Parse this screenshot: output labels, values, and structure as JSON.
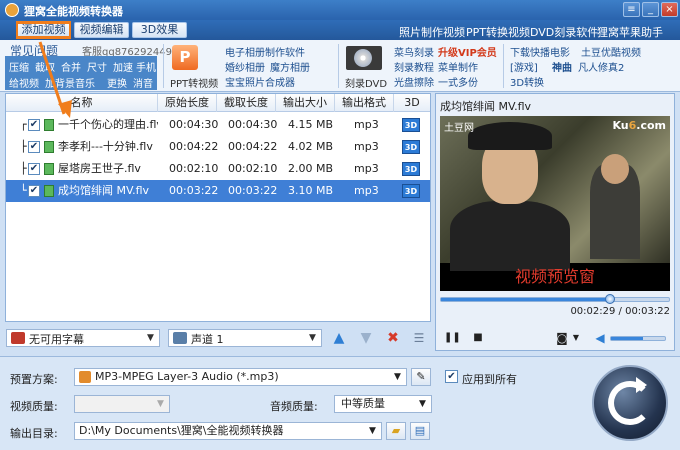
{
  "app": {
    "title": "狸窝全能视频转换器"
  },
  "toolbar": {
    "tabs": [
      "添加视频",
      "视频编辑",
      "3D效果"
    ],
    "links": [
      "照片制作视频",
      "PPT转换视频",
      "DVD刻录软件",
      "狸窝苹果助手"
    ]
  },
  "promo": {
    "heading": "常见问题",
    "qq": "客服qq876292449",
    "tiles": [
      "压缩",
      "截取",
      "合并",
      "尺寸",
      "加速",
      "手机",
      "给视频",
      "加背景音乐",
      "更换",
      "消音"
    ],
    "ppt_label": "PPT转视频",
    "photo_links": [
      "电子相册制作软件",
      "婚纱相册",
      "魔方相册",
      "宝宝照片合成器"
    ],
    "dvd_label": "刻录DVD",
    "dvd_links": [
      "菜鸟刻录",
      "升级VIP会员",
      "刻录教程",
      "菜单制作",
      "光盘擦除",
      "一式多份"
    ],
    "right_links": [
      "下载快播电影",
      "土豆优酷视频",
      "[游戏]",
      "神曲",
      "凡人修真2",
      "3D转换"
    ]
  },
  "file_list": {
    "columns": [
      "名称",
      "原始长度",
      "截取长度",
      "输出大小",
      "输出格式",
      "3D"
    ],
    "rows": [
      {
        "name": "一千个伤心的理由.flv",
        "orig": "00:04:30",
        "cut": "00:04:30",
        "size": "4.15 MB",
        "format": "mp3",
        "badge": "3D",
        "checked": "✔"
      },
      {
        "name": "李孝利---十分钟.flv",
        "orig": "00:04:22",
        "cut": "00:04:22",
        "size": "4.02 MB",
        "format": "mp3",
        "badge": "3D",
        "checked": "✔"
      },
      {
        "name": "屋塔房王世子.flv",
        "orig": "00:02:10",
        "cut": "00:02:10",
        "size": "2.00 MB",
        "format": "mp3",
        "badge": "3D",
        "checked": "✔"
      },
      {
        "name": "成均馆绯闻 MV.flv",
        "orig": "00:03:22",
        "cut": "00:03:22",
        "size": "3.10 MB",
        "format": "mp3",
        "badge": "3D",
        "checked": "✔"
      }
    ]
  },
  "list_controls": {
    "subtitle_value": "无可用字幕",
    "audio_track_value": "声道 1"
  },
  "preview": {
    "title": "成均馆绯闻 MV.flv",
    "watermark_left": "土豆网",
    "watermark_right_a": "Ku",
    "watermark_right_b": "6",
    "watermark_right_c": ".com",
    "caption": "视频预览窗",
    "time_readout": "00:02:29 / 00:03:22",
    "progress": 0.74,
    "volume": 0.6
  },
  "output": {
    "preset_label": "预置方案:",
    "preset_value": "MP3-MPEG Layer-3 Audio (*.mp3)",
    "apply_all_label": "应用到所有",
    "apply_all_checked": "✔",
    "video_quality_label": "视频质量:",
    "audio_quality_label": "音频质量:",
    "audio_quality_value": "中等质量",
    "dir_label": "输出目录:",
    "dir_value": "D:\\My Documents\\狸窝\\全能视频转换器"
  },
  "colors": {
    "accent": "#f07d1c",
    "selection": "#3f7fd6",
    "caption": "#e33b2d"
  }
}
